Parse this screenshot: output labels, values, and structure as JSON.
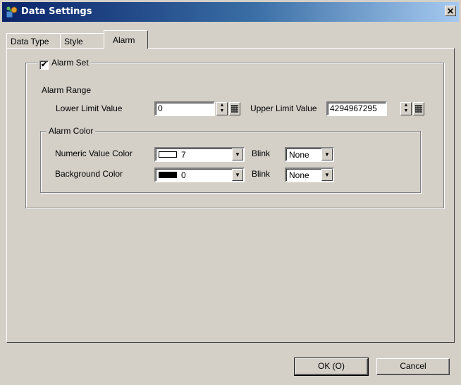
{
  "window": {
    "title": "Data Settings",
    "close_glyph": "✕"
  },
  "tabs": [
    {
      "label": "Data Type",
      "active": false
    },
    {
      "label": "Style",
      "active": false
    },
    {
      "label": "Alarm",
      "active": true
    }
  ],
  "alarm": {
    "alarm_set_label": "Alarm Set",
    "alarm_set_checked": true,
    "alarm_range_label": "Alarm Range",
    "lower_limit_label": "Lower Limit Value",
    "lower_limit_value": "0",
    "upper_limit_label": "Upper Limit Value",
    "upper_limit_value": "4294967295",
    "alarm_color_label": "Alarm Color",
    "numeric_color_label": "Numeric Value Color",
    "numeric_color_value": "7",
    "numeric_color_swatch": "#ffffff",
    "background_color_label": "Background Color",
    "background_color_value": "0",
    "background_color_swatch": "#000000",
    "blink_label": "Blink",
    "numeric_blink_value": "None",
    "background_blink_value": "None"
  },
  "buttons": {
    "ok_label": "OK (O)",
    "cancel_label": "Cancel"
  },
  "icons": {
    "app": "data-settings-icon",
    "spin": "spin-updown-icon",
    "calc": "keypad-icon",
    "dropdown": "chevron-down-icon"
  }
}
